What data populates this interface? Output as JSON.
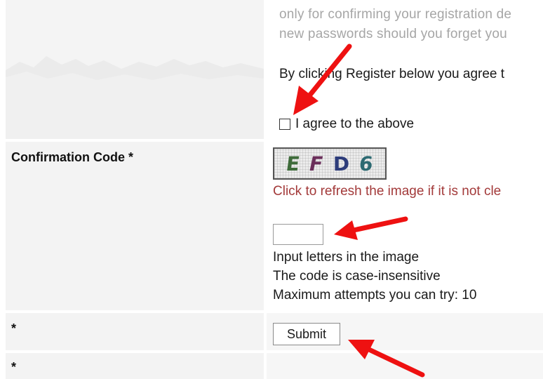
{
  "terms": {
    "faded_line_1": "only for confirming your registration de",
    "faded_line_2": "new passwords should you forget you",
    "agree_notice": "By clicking Register below you agree t",
    "checkbox_label": "I agree to the above",
    "checkbox_checked": false
  },
  "confirmation": {
    "label": "Confirmation Code *",
    "captcha_chars": [
      "E",
      "F",
      "D",
      "6"
    ],
    "refresh_text": "Click to refresh the image if it is not cle",
    "input_value": "",
    "instruction_1": "Input letters in the image",
    "instruction_2": "The code is case-insensitive",
    "instruction_3": "Maximum attempts you can try: 10"
  },
  "submit_row": {
    "star": "*",
    "submit_label": "Submit"
  },
  "last_row": {
    "star": "*"
  },
  "colors": {
    "arrow": "#ee1111",
    "refresh_text": "#a33a3a",
    "faded_text": "#a6a6a6",
    "left_cell_bg": "#f3f3f3"
  }
}
